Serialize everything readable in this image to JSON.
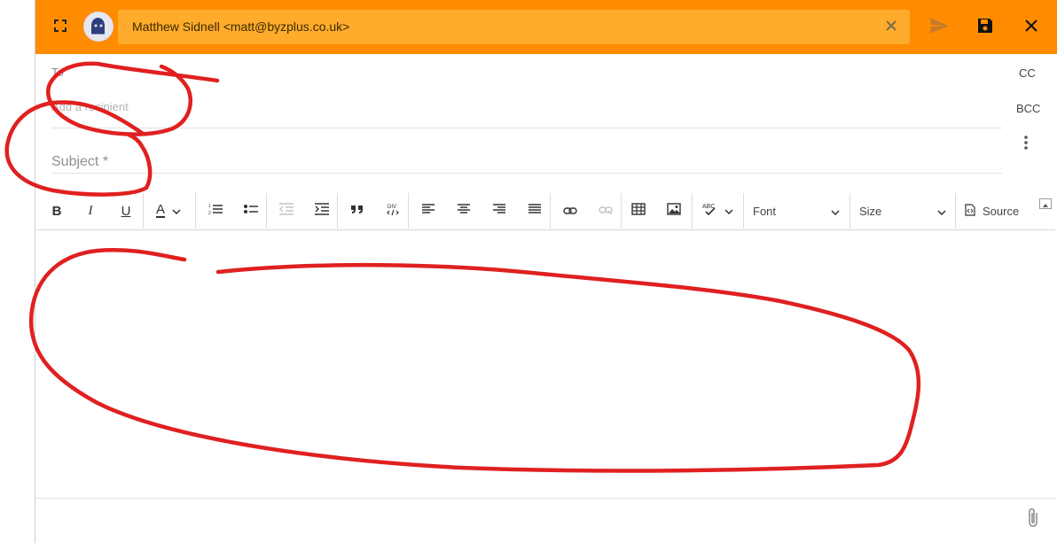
{
  "header": {
    "from_display": "Matthew Sidnell <matt@byzplus.co.uk>",
    "accent_color": "#ff8c00",
    "from_box_color": "#ffab2c",
    "icons": [
      "fullscreen-icon",
      "avatar",
      "clear-icon",
      "send-icon",
      "save-icon",
      "close-icon"
    ]
  },
  "recipients": {
    "to_label": "To",
    "to_placeholder": "Add a recipient",
    "cc_label": "CC",
    "bcc_label": "BCC"
  },
  "subject": {
    "placeholder": "Subject *"
  },
  "toolbar": {
    "bold": "B",
    "italic": "I",
    "underline": "U",
    "text_color": "A",
    "font_label": "Font",
    "size_label": "Size",
    "source_label": "Source",
    "icons": [
      "numbered-list-icon",
      "bulleted-list-icon",
      "outdent-icon",
      "indent-icon",
      "blockquote-icon",
      "div-container-icon",
      "align-left-icon",
      "align-center-icon",
      "align-right-icon",
      "justify-icon",
      "link-icon",
      "unlink-icon",
      "table-icon",
      "image-icon",
      "spellcheck-icon",
      "source-icon"
    ]
  },
  "footer": {
    "icons": [
      "paperclip-icon"
    ]
  },
  "annotations": {
    "color": "#e02020"
  }
}
